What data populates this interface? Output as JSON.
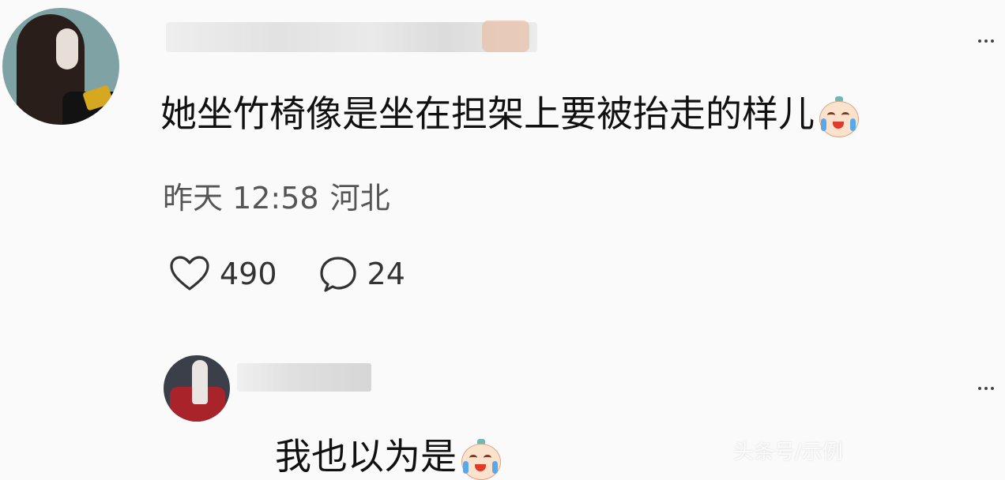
{
  "comment": {
    "text": "她坐竹椅像是坐在担架上要被抬走的样儿",
    "emoji_icon": "crying-face-icon",
    "time": "昨天 12:58",
    "location": "河北",
    "likes": "490",
    "replies": "24",
    "like_icon": "heart-icon",
    "reply_icon": "speech-bubble-icon",
    "more_icon": "more-dots-icon"
  },
  "reply": {
    "text": "我也以为是",
    "emoji_icon": "crying-face-icon",
    "more_icon": "more-dots-icon"
  },
  "watermark": "头条号/示例"
}
